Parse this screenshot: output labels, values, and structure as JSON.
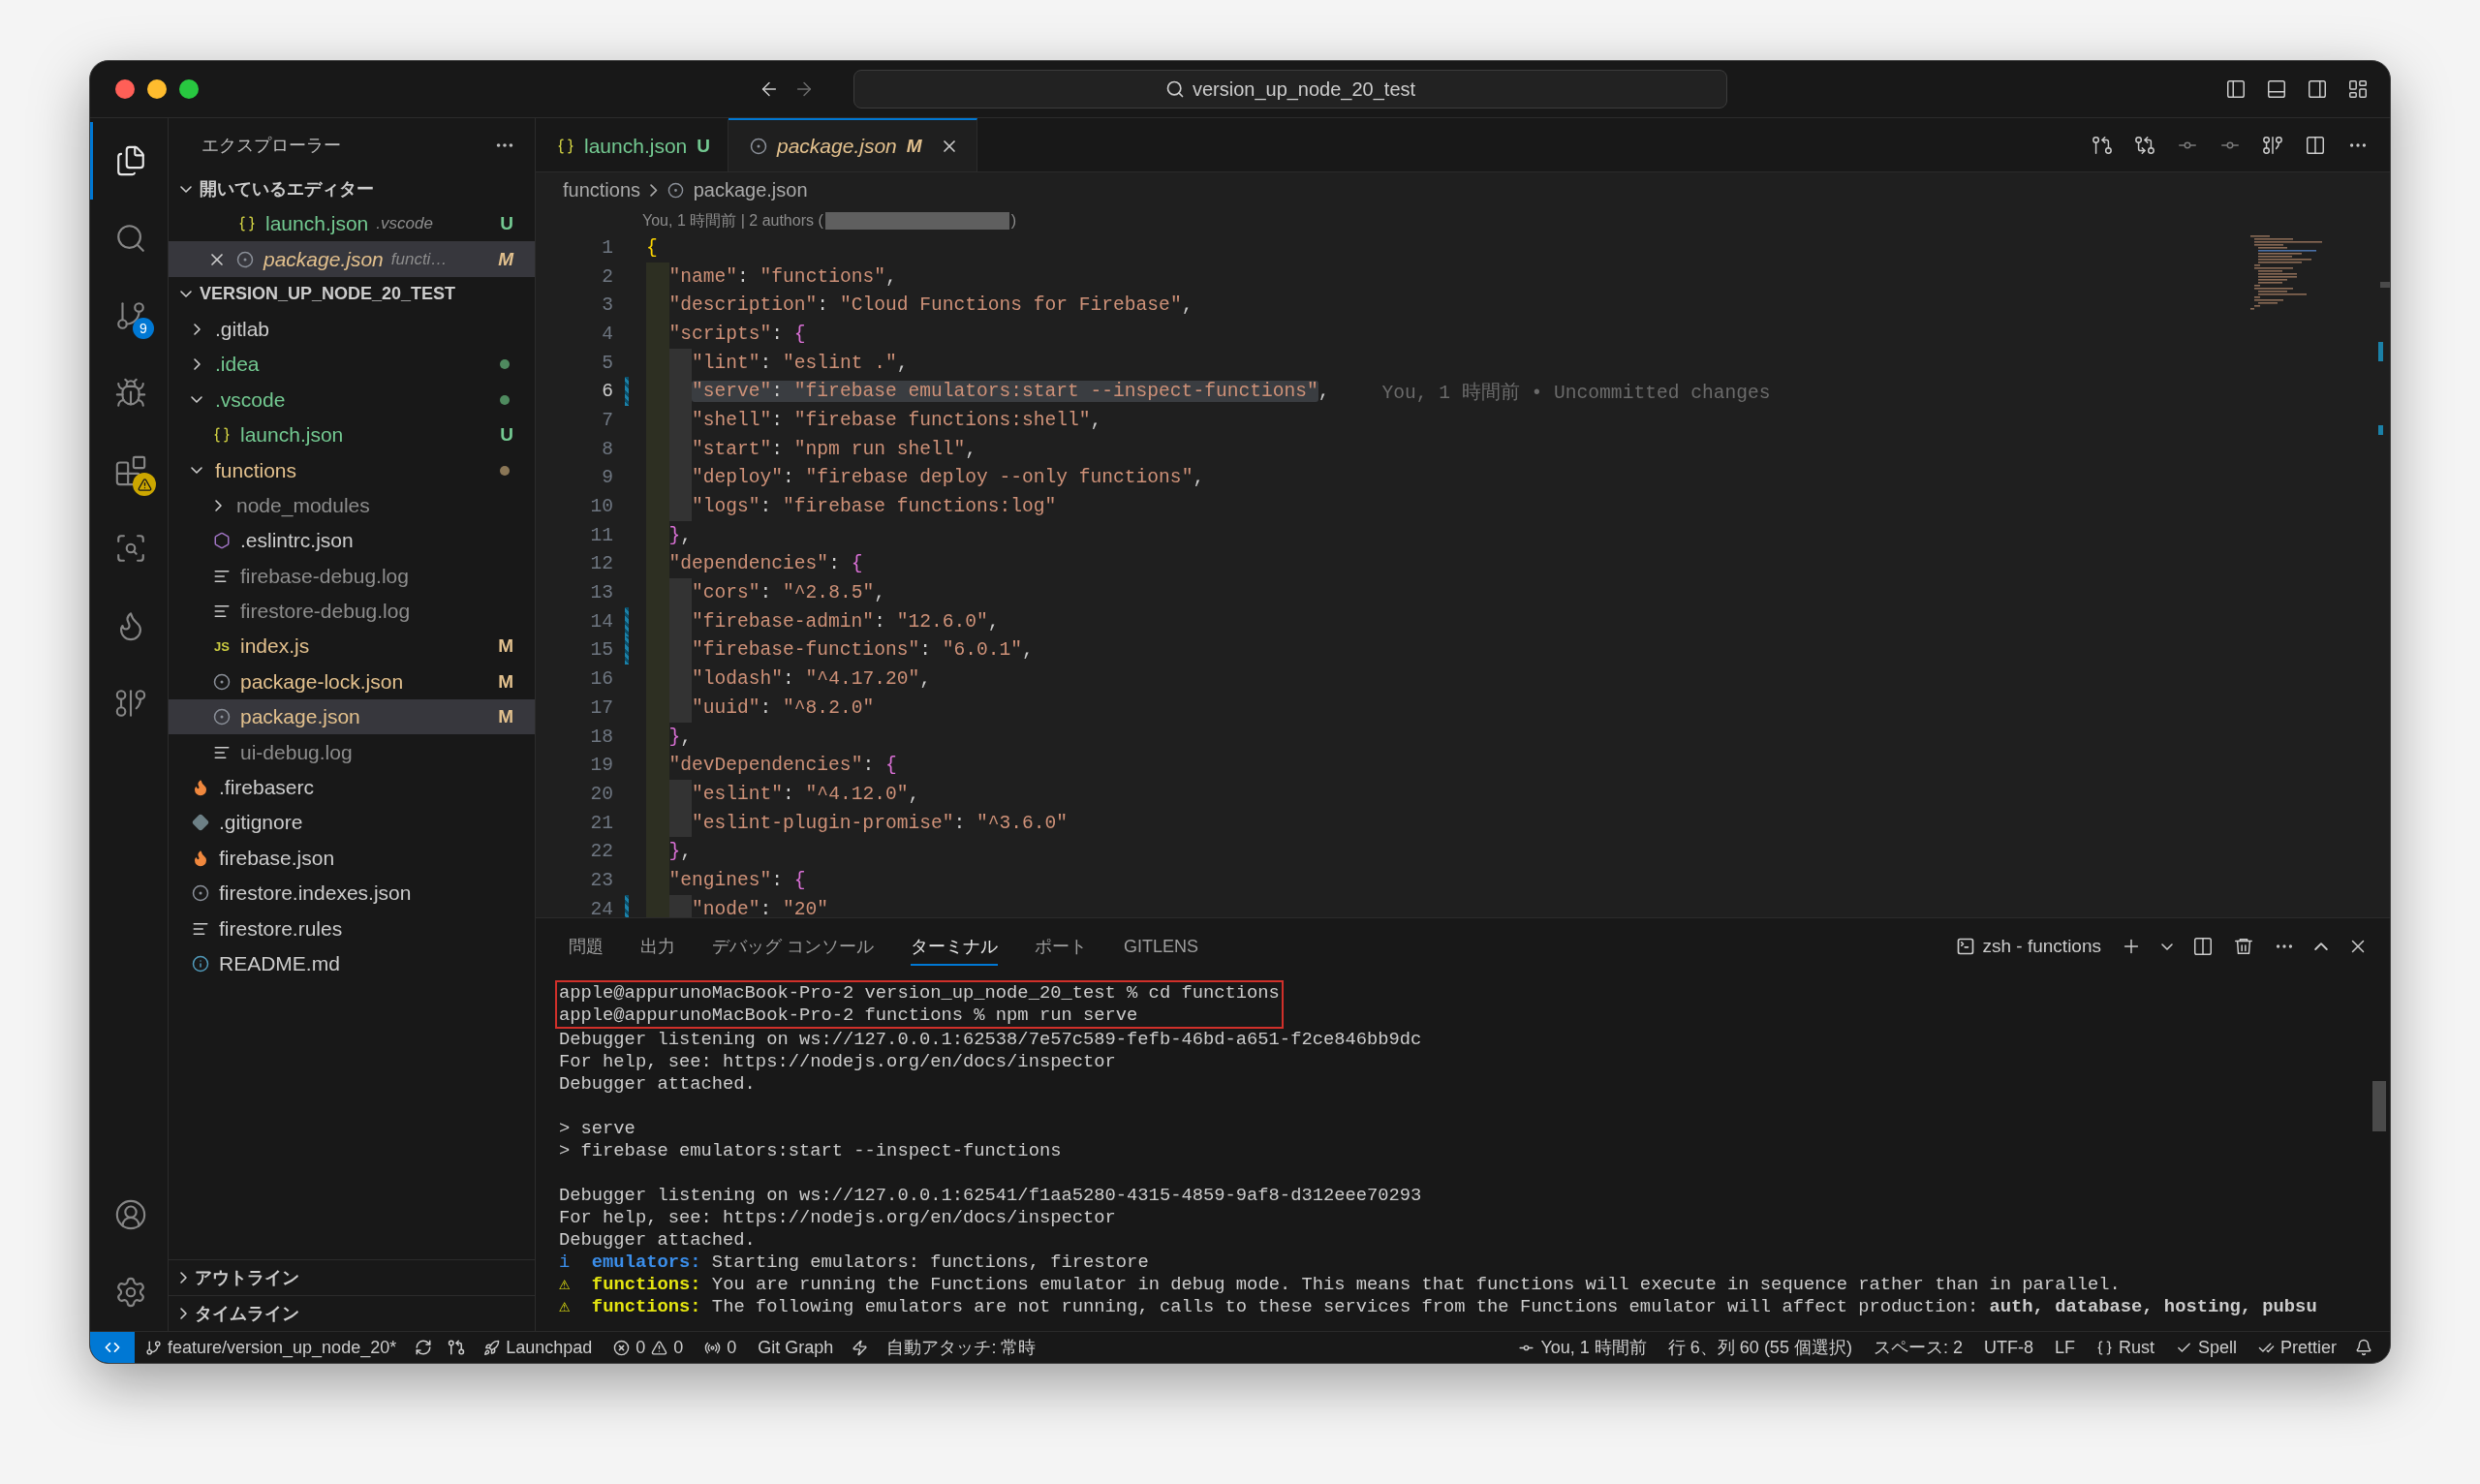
{
  "title_bar": {
    "search": "version_up_node_20_test"
  },
  "activity_bar": {
    "items": [
      {
        "kind": "explorer",
        "selected": true
      },
      {
        "kind": "search",
        "selected": false
      },
      {
        "kind": "source_control",
        "selected": false,
        "badge": "9"
      },
      {
        "kind": "run_debug",
        "selected": false
      },
      {
        "kind": "extensions",
        "selected": false,
        "warning": true
      },
      {
        "kind": "remote_explorer",
        "selected": false
      },
      {
        "kind": "firebase",
        "selected": false
      },
      {
        "kind": "git_graph",
        "selected": false
      }
    ]
  },
  "explorer": {
    "title": "エクスプローラー",
    "open_editors": {
      "title": "開いているエディター",
      "expanded": true,
      "items": [
        {
          "name": "launch.json",
          "folder": ".vscode",
          "badge": "U",
          "color": "#73c991",
          "kind": "json",
          "preview": false,
          "selected": false
        },
        {
          "name": "package.json",
          "folder": "functi…",
          "badge": "M",
          "color": "#e2c08d",
          "kind": "npm",
          "preview": true,
          "selected": true
        }
      ]
    },
    "workspace": {
      "title": "VERSION_UP_NODE_20_TEST",
      "expanded": true,
      "items": [
        {
          "name": ".gitlab",
          "kind": "folder",
          "expanded": false,
          "color": "#cccccc",
          "selected": false
        },
        {
          "name": ".idea",
          "kind": "folder",
          "expanded": false,
          "color": "#73c991",
          "dot": {
            "color": "#4f8a5f"
          },
          "selected": false
        },
        {
          "name": ".vscode",
          "kind": "folder",
          "expanded": true,
          "color": "#73c991",
          "dot": {
            "color": "#4f8a5f"
          },
          "selected": false,
          "children": [
            {
              "name": "launch.json",
              "kind": "json",
              "color": "#73c991",
              "badge": "U",
              "selected": false
            }
          ]
        },
        {
          "name": "functions",
          "kind": "folder",
          "expanded": true,
          "color": "#e2c08d",
          "dot": {
            "color": "#8a7656"
          },
          "selected": false,
          "children": [
            {
              "name": "node_modules",
              "kind": "folder",
              "expanded": false,
              "color": "#8c8c8c",
              "selected": false
            },
            {
              "name": ".eslintrc.json",
              "kind": "eslint",
              "color": "#cccccc",
              "selected": false
            },
            {
              "name": "firebase-debug.log",
              "kind": "log",
              "color": "#8c8c8c",
              "selected": false
            },
            {
              "name": "firestore-debug.log",
              "kind": "log",
              "color": "#8c8c8c",
              "selected": false
            },
            {
              "name": "index.js",
              "kind": "js",
              "icon_text": "JS",
              "color": "#e2c08d",
              "badge": "M",
              "selected": false
            },
            {
              "name": "package-lock.json",
              "kind": "npm",
              "color": "#e2c08d",
              "badge": "M",
              "selected": false
            },
            {
              "name": "package.json",
              "kind": "npm",
              "color": "#e2c08d",
              "badge": "M",
              "selected": true
            },
            {
              "name": "ui-debug.log",
              "kind": "log",
              "color": "#8c8c8c",
              "selected": false
            }
          ]
        },
        {
          "name": ".firebaserc",
          "kind": "firebase",
          "color": "#cccccc",
          "selected": false
        },
        {
          "name": ".gitignore",
          "kind": "git",
          "color": "#cccccc",
          "selected": false
        },
        {
          "name": "firebase.json",
          "kind": "firebase",
          "color": "#cccccc",
          "selected": false
        },
        {
          "name": "firestore.indexes.json",
          "kind": "npm",
          "color": "#cccccc",
          "selected": false
        },
        {
          "name": "firestore.rules",
          "kind": "log",
          "color": "#cccccc",
          "selected": false
        },
        {
          "name": "README.md",
          "kind": "info",
          "color": "#cccccc",
          "selected": false
        }
      ]
    },
    "sections": [
      {
        "title": "アウトライン",
        "expanded": false
      },
      {
        "title": "タイムライン",
        "expanded": false
      }
    ]
  },
  "editor": {
    "tabs": [
      {
        "name": "launch.json",
        "badge": "U",
        "kind": "json",
        "color": "#73c991",
        "preview": false,
        "selected": false
      },
      {
        "name": "package.json",
        "badge": "M",
        "kind": "npm",
        "color": "#e2c08d",
        "preview": true,
        "selected": true
      }
    ],
    "breadcrumb": [
      "functions",
      "package.json"
    ],
    "blame_header": {
      "before": "You, 1 時間前 | 2 authors (",
      "after": ")"
    },
    "lines": [
      {
        "number": "1",
        "current": false,
        "changed": false,
        "tokens": [
          {
            "kind": "brace1",
            "text": "{"
          }
        ]
      },
      {
        "number": "2",
        "current": false,
        "changed": false,
        "tokens": [
          {
            "kind": "str",
            "text": "  \"name\""
          },
          {
            "kind": "punct",
            "text": ": "
          },
          {
            "kind": "str",
            "text": "\"functions\""
          },
          {
            "kind": "punct",
            "text": ","
          }
        ]
      },
      {
        "number": "3",
        "current": false,
        "changed": false,
        "tokens": [
          {
            "kind": "str",
            "text": "  \"description\""
          },
          {
            "kind": "punct",
            "text": ": "
          },
          {
            "kind": "str",
            "text": "\"Cloud Functions for Firebase\""
          },
          {
            "kind": "punct",
            "text": ","
          }
        ]
      },
      {
        "number": "4",
        "current": false,
        "changed": false,
        "tokens": [
          {
            "kind": "str",
            "text": "  \"scripts\""
          },
          {
            "kind": "punct",
            "text": ": "
          },
          {
            "kind": "brace2",
            "text": "{"
          }
        ]
      },
      {
        "number": "5",
        "current": false,
        "changed": false,
        "tokens": [
          {
            "kind": "str",
            "text": "    \"lint\""
          },
          {
            "kind": "punct",
            "text": ": "
          },
          {
            "kind": "str",
            "text": "\"eslint .\""
          },
          {
            "kind": "punct",
            "text": ","
          }
        ]
      },
      {
        "number": "6",
        "current": true,
        "changed": true,
        "blame": "You, 1 時間前 • Uncommitted changes",
        "tokens": [
          {
            "kind": "selection",
            "tokens": [
              {
                "kind": "str",
                "text": "    \"serve\""
              },
              {
                "kind": "punct",
                "text": ": "
              },
              {
                "kind": "str",
                "text": "\"firebase emulators:start --inspect-functions\""
              }
            ]
          },
          {
            "kind": "punct",
            "text": ","
          }
        ]
      },
      {
        "number": "7",
        "current": false,
        "changed": false,
        "tokens": [
          {
            "kind": "str",
            "text": "    \"shell\""
          },
          {
            "kind": "punct",
            "text": ": "
          },
          {
            "kind": "str",
            "text": "\"firebase functions:shell\""
          },
          {
            "kind": "punct",
            "text": ","
          }
        ]
      },
      {
        "number": "8",
        "current": false,
        "changed": false,
        "tokens": [
          {
            "kind": "str",
            "text": "    \"start\""
          },
          {
            "kind": "punct",
            "text": ": "
          },
          {
            "kind": "str",
            "text": "\"npm run shell\""
          },
          {
            "kind": "punct",
            "text": ","
          }
        ]
      },
      {
        "number": "9",
        "current": false,
        "changed": false,
        "tokens": [
          {
            "kind": "str",
            "text": "    \"deploy\""
          },
          {
            "kind": "punct",
            "text": ": "
          },
          {
            "kind": "str",
            "text": "\"firebase deploy --only functions\""
          },
          {
            "kind": "punct",
            "text": ","
          }
        ]
      },
      {
        "number": "10",
        "current": false,
        "changed": false,
        "tokens": [
          {
            "kind": "str",
            "text": "    \"logs\""
          },
          {
            "kind": "punct",
            "text": ": "
          },
          {
            "kind": "str",
            "text": "\"firebase functions:log\""
          }
        ]
      },
      {
        "number": "11",
        "current": false,
        "changed": false,
        "tokens": [
          {
            "kind": "brace2",
            "text": "  }"
          },
          {
            "kind": "punct",
            "text": ","
          }
        ]
      },
      {
        "number": "12",
        "current": false,
        "changed": false,
        "tokens": [
          {
            "kind": "str",
            "text": "  \"dependencies\""
          },
          {
            "kind": "punct",
            "text": ": "
          },
          {
            "kind": "brace2",
            "text": "{"
          }
        ]
      },
      {
        "number": "13",
        "current": false,
        "changed": false,
        "tokens": [
          {
            "kind": "str",
            "text": "    \"cors\""
          },
          {
            "kind": "punct",
            "text": ": "
          },
          {
            "kind": "str",
            "text": "\"^2.8.5\""
          },
          {
            "kind": "punct",
            "text": ","
          }
        ]
      },
      {
        "number": "14",
        "current": false,
        "changed": true,
        "tokens": [
          {
            "kind": "str",
            "text": "    \"firebase-admin\""
          },
          {
            "kind": "punct",
            "text": ": "
          },
          {
            "kind": "str",
            "text": "\"12.6.0\""
          },
          {
            "kind": "punct",
            "text": ","
          }
        ]
      },
      {
        "number": "15",
        "current": false,
        "changed": true,
        "tokens": [
          {
            "kind": "str",
            "text": "    \"firebase-functions\""
          },
          {
            "kind": "punct",
            "text": ": "
          },
          {
            "kind": "str",
            "text": "\"6.0.1\""
          },
          {
            "kind": "punct",
            "text": ","
          }
        ]
      },
      {
        "number": "16",
        "current": false,
        "changed": false,
        "tokens": [
          {
            "kind": "str",
            "text": "    \"lodash\""
          },
          {
            "kind": "punct",
            "text": ": "
          },
          {
            "kind": "str",
            "text": "\"^4.17.20\""
          },
          {
            "kind": "punct",
            "text": ","
          }
        ]
      },
      {
        "number": "17",
        "current": false,
        "changed": false,
        "tokens": [
          {
            "kind": "str",
            "text": "    \"uuid\""
          },
          {
            "kind": "punct",
            "text": ": "
          },
          {
            "kind": "str",
            "text": "\"^8.2.0\""
          }
        ]
      },
      {
        "number": "18",
        "current": false,
        "changed": false,
        "tokens": [
          {
            "kind": "brace2",
            "text": "  }"
          },
          {
            "kind": "punct",
            "text": ","
          }
        ]
      },
      {
        "number": "19",
        "current": false,
        "changed": false,
        "tokens": [
          {
            "kind": "str",
            "text": "  \"devDependencies\""
          },
          {
            "kind": "punct",
            "text": ": "
          },
          {
            "kind": "brace2",
            "text": "{"
          }
        ]
      },
      {
        "number": "20",
        "current": false,
        "changed": false,
        "tokens": [
          {
            "kind": "str",
            "text": "    \"eslint\""
          },
          {
            "kind": "punct",
            "text": ": "
          },
          {
            "kind": "str",
            "text": "\"^4.12.0\""
          },
          {
            "kind": "punct",
            "text": ","
          }
        ]
      },
      {
        "number": "21",
        "current": false,
        "changed": false,
        "tokens": [
          {
            "kind": "str",
            "text": "    \"eslint-plugin-promise\""
          },
          {
            "kind": "punct",
            "text": ": "
          },
          {
            "kind": "str",
            "text": "\"^3.6.0\""
          }
        ]
      },
      {
        "number": "22",
        "current": false,
        "changed": false,
        "tokens": [
          {
            "kind": "brace2",
            "text": "  }"
          },
          {
            "kind": "punct",
            "text": ","
          }
        ]
      },
      {
        "number": "23",
        "current": false,
        "changed": false,
        "tokens": [
          {
            "kind": "str",
            "text": "  \"engines\""
          },
          {
            "kind": "punct",
            "text": ": "
          },
          {
            "kind": "brace2",
            "text": "{"
          }
        ]
      },
      {
        "number": "24",
        "current": false,
        "changed": true,
        "tokens": [
          {
            "kind": "str",
            "text": "    \"node\""
          },
          {
            "kind": "punct",
            "text": ": "
          },
          {
            "kind": "str",
            "text": "\"20\""
          }
        ]
      }
    ]
  },
  "panel": {
    "tabs": [
      {
        "label": "問題",
        "selected": false
      },
      {
        "label": "出力",
        "selected": false
      },
      {
        "label": "デバッグ コンソール",
        "selected": false
      },
      {
        "label": "ターミナル",
        "selected": true
      },
      {
        "label": "ポート",
        "selected": false
      },
      {
        "label": "GITLENS",
        "selected": false
      }
    ],
    "terminal_name": "zsh - functions",
    "blocks": [
      {
        "kind": "outlined",
        "lines": [
          {
            "kind": "text",
            "text": "apple@appurunoMacBook-Pro-2 version_up_node_20_test % cd functions"
          },
          {
            "kind": "text",
            "text": "apple@appurunoMacBook-Pro-2 functions % npm run serve"
          }
        ]
      },
      {
        "kind": "plain",
        "lines": [
          {
            "kind": "text",
            "text": "Debugger listening on ws://127.0.0.1:62538/7e57c589-fefb-46bd-a651-f2ce846bb9dc"
          },
          {
            "kind": "text",
            "text": "For help, see: https://nodejs.org/en/docs/inspector"
          },
          {
            "kind": "text",
            "text": "Debugger attached."
          },
          {
            "kind": "blank"
          },
          {
            "kind": "text",
            "text": "> serve"
          },
          {
            "kind": "text",
            "text": "> firebase emulators:start --inspect-functions"
          },
          {
            "kind": "blank"
          },
          {
            "kind": "text",
            "text": "Debugger listening on ws://127.0.0.1:62541/f1aa5280-4315-4859-9af8-d312eee70293"
          },
          {
            "kind": "text",
            "text": "For help, see: https://nodejs.org/en/docs/inspector"
          },
          {
            "kind": "text",
            "text": "Debugger attached."
          },
          {
            "kind": "info",
            "mark": "i",
            "label": "emulators:",
            "text": "Starting emulators: functions, firestore"
          },
          {
            "kind": "warning",
            "mark": "⚠",
            "label": "functions:",
            "text": "You are running the Functions emulator in debug mode. This means that functions will execute in sequence rather than in parallel."
          },
          {
            "kind": "warning",
            "mark": "⚠",
            "label": "functions:",
            "text": "The following emulators are not running, calls to these services from the Functions emulator will affect production: **auth, database, hosting, pubsu**"
          }
        ]
      }
    ]
  },
  "status_bar": {
    "branch": "feature/version_up_node_20*",
    "launchpad": "Launchpad",
    "errors": "0",
    "warnings": "0",
    "ports": "0",
    "git_graph": "Git Graph",
    "auto_attach": "自動アタッチ: 常時",
    "blame": "You, 1 時間前",
    "cursor": "行 6、列 60 (55 個選択)",
    "indentation": "スペース: 2",
    "encoding": "UTF-8",
    "eol": "LF",
    "language": "Rust",
    "spell": "Spell",
    "prettier": "Prettier"
  }
}
